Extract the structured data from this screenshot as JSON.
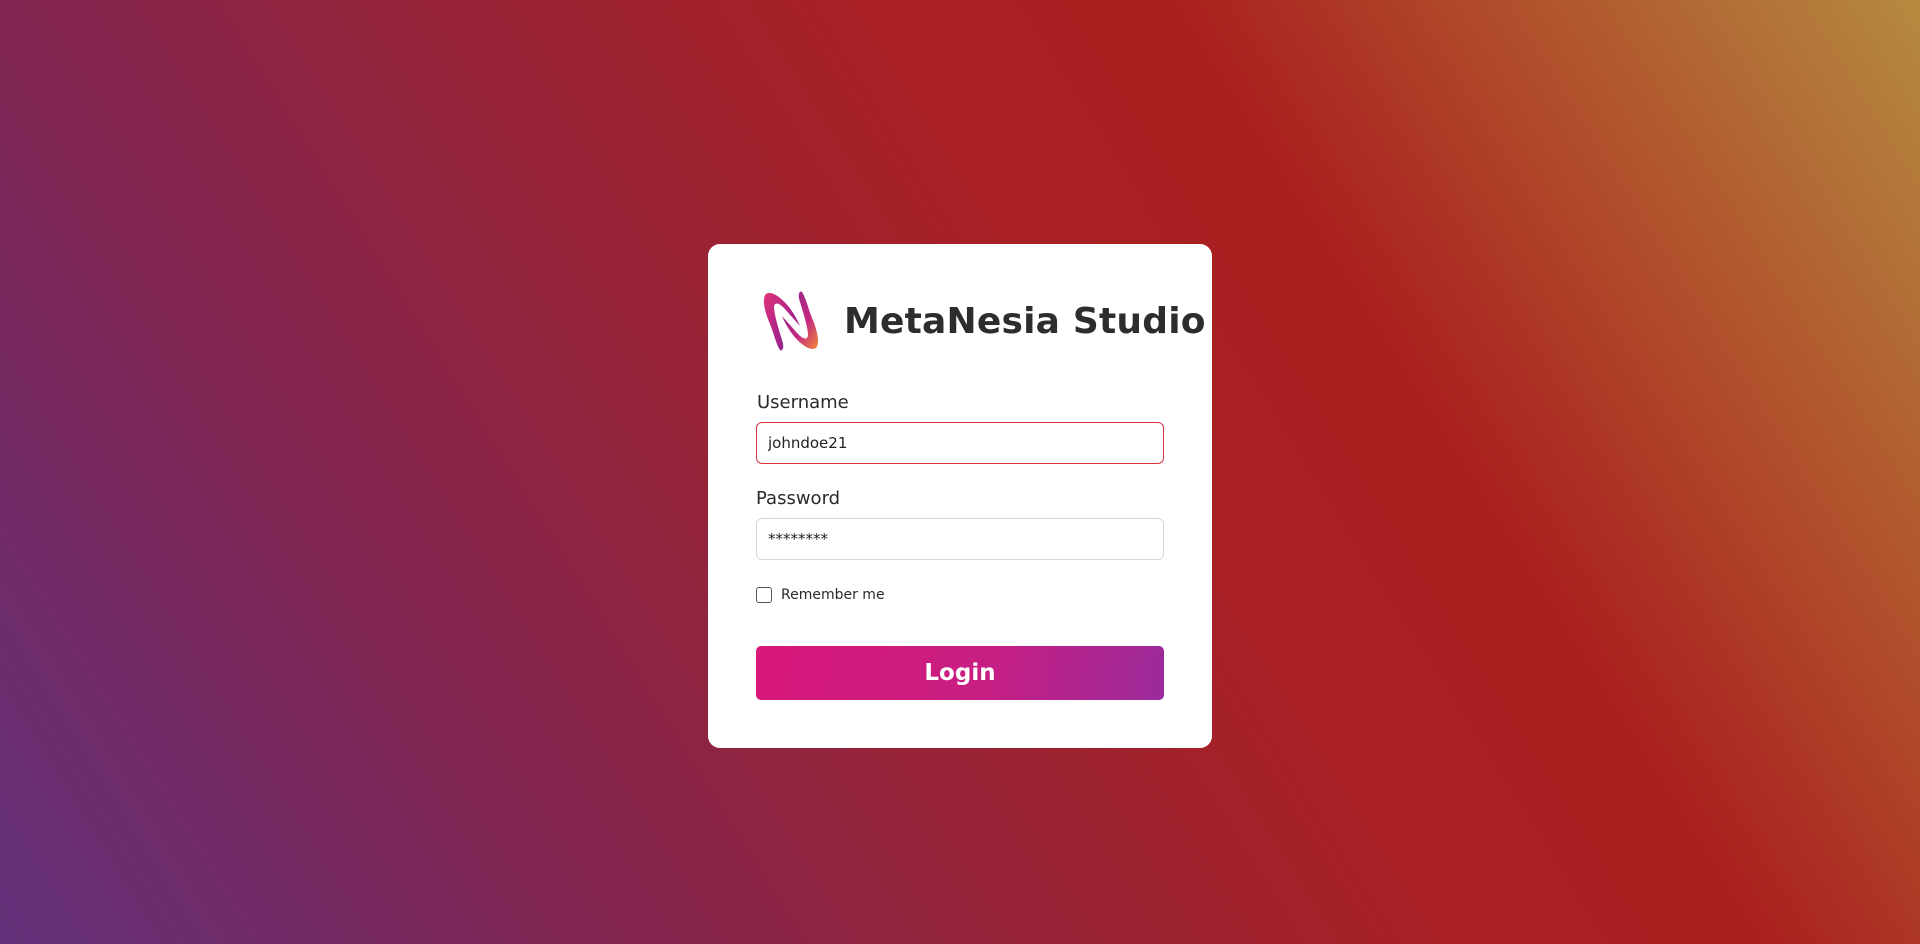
{
  "brand": {
    "name": "MetaNesia Studio",
    "logo_icon": "metanesia-logo-icon"
  },
  "form": {
    "username_label": "Username",
    "username_value": "johndoe21",
    "password_label": "Password",
    "password_value": "********",
    "remember_label": "Remember me",
    "remember_checked": false,
    "login_label": "Login"
  },
  "colors": {
    "accent": "#d8187a",
    "accent_end": "#9a2a9a",
    "error_border": "#d9343a",
    "brand_text": "#2d2d2d"
  }
}
